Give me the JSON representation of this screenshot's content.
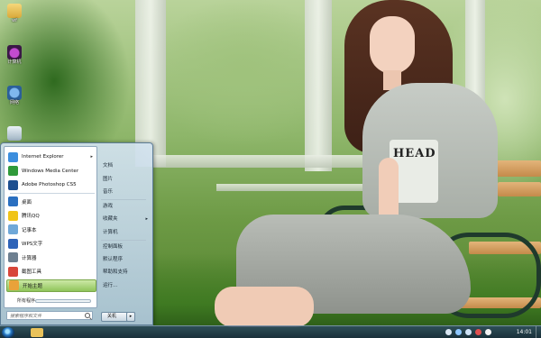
{
  "desktop": {
    "icons": [
      {
        "label": "wf",
        "icon": "folder-icon"
      },
      {
        "label": "计算机",
        "icon": "computer-icon"
      },
      {
        "label": "网络",
        "icon": "network-icon"
      },
      {
        "label": "",
        "icon": "recycle-bin-icon"
      }
    ],
    "wallpaper": {
      "shirt_text": "HEAD"
    }
  },
  "start_menu": {
    "programs": [
      {
        "label": "Internet Explorer",
        "icon": "internet-explorer-icon",
        "color": "#3b8ede",
        "submenu": true
      },
      {
        "label": "Windows Media Center",
        "icon": "media-center-icon",
        "color": "#2f9a3a",
        "submenu": false
      },
      {
        "label": "Adobe Photoshop CS5",
        "icon": "photoshop-icon",
        "color": "#1d4f8f",
        "submenu": false
      },
      {
        "label": "桌面",
        "icon": "desktop-app-icon",
        "color": "#2a6fc0",
        "submenu": false
      },
      {
        "label": "腾讯QQ",
        "icon": "qq-icon",
        "color": "#f0c419",
        "submenu": false
      },
      {
        "label": "记事本",
        "icon": "notepad-icon",
        "color": "#6fa8d8",
        "submenu": false
      },
      {
        "label": "WPS文字",
        "icon": "wps-icon",
        "color": "#2d63b8",
        "submenu": false
      },
      {
        "label": "计算器",
        "icon": "calculator-icon",
        "color": "#6d7f90",
        "submenu": false
      },
      {
        "label": "截图工具",
        "icon": "snipping-tool-icon",
        "color": "#d8463a",
        "submenu": false
      },
      {
        "label": "开始主题",
        "icon": "start-theme-icon",
        "color": "#e9a23a",
        "submenu": false
      }
    ],
    "highlighted_index": 9,
    "all_programs_label": "所有程序",
    "search_placeholder": "搜索程序和文件",
    "right_items": [
      {
        "label": "文档",
        "submenu": false
      },
      {
        "label": "图片",
        "submenu": false
      },
      {
        "label": "音乐",
        "submenu": false
      },
      {
        "label": "游戏",
        "submenu": false
      },
      {
        "label": "收藏夹",
        "submenu": true
      },
      {
        "label": "计算机",
        "submenu": false
      },
      {
        "label": "控制面板",
        "submenu": false
      },
      {
        "label": "默认程序",
        "submenu": false
      },
      {
        "label": "帮助和支持",
        "submenu": false
      },
      {
        "label": "运行...",
        "submenu": false
      }
    ],
    "shutdown_label": "关机",
    "shutdown_arrow": "▸"
  },
  "taskbar": {
    "clock": "14:01",
    "buttons": [
      {
        "icon": "folder-icon",
        "color": "#e9c25a"
      }
    ],
    "tray_icons": [
      {
        "icon": "language-icon",
        "color": "#d9e6f2"
      },
      {
        "icon": "network-tray-icon",
        "color": "#8fc7ff"
      },
      {
        "icon": "volume-icon",
        "color": "#cfe3f7"
      },
      {
        "icon": "security-icon",
        "color": "#e05050"
      },
      {
        "icon": "flag-icon",
        "color": "#f2f2f2"
      }
    ]
  }
}
